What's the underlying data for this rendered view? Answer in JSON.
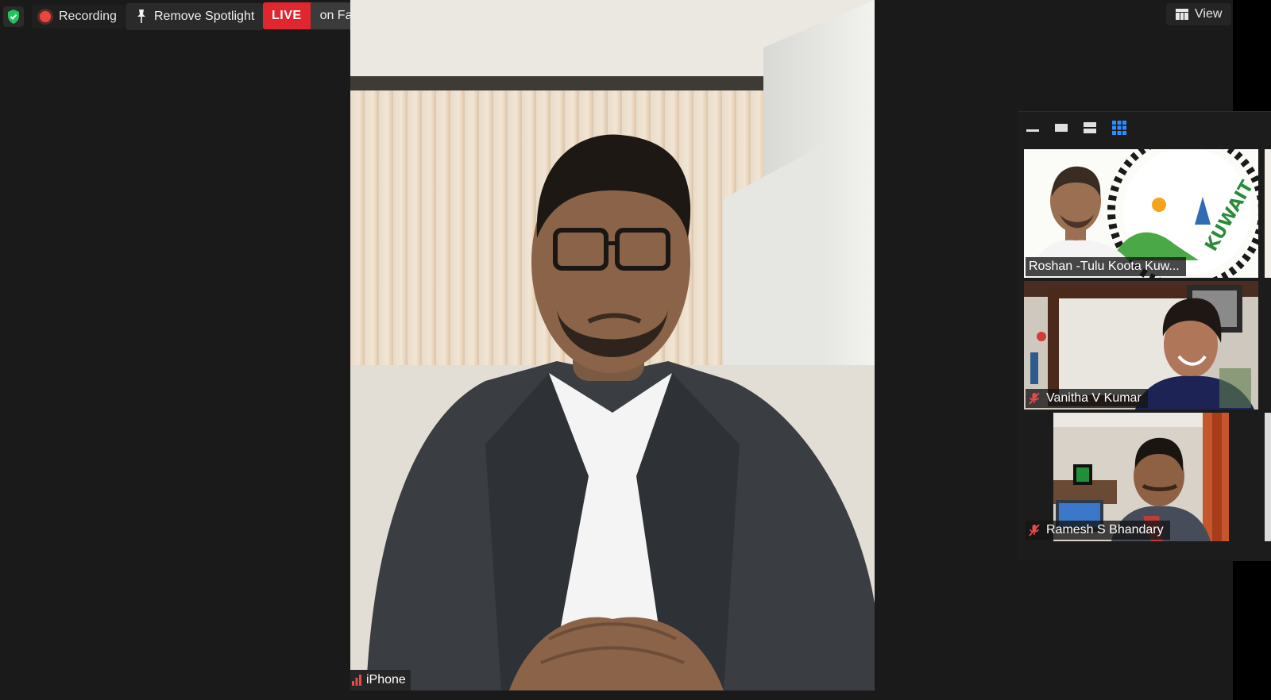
{
  "toolbar": {
    "recording_label": "Recording",
    "spotlight_label": "Remove Spotlight",
    "live_badge": "LIVE",
    "live_destination": "on Facebook",
    "view_label": "View"
  },
  "main_video": {
    "participant_name": "iPhone"
  },
  "gallery": {
    "tiles": [
      {
        "name": "Roshan -Tulu Koota Kuw...",
        "muted": false
      },
      {
        "name": "Vanitha V Kumar",
        "muted": true
      },
      {
        "name": "Ramesh S Bhandary",
        "muted": true
      }
    ],
    "logo_text": "KUWAIT"
  },
  "colors": {
    "live_red": "#e0262f",
    "shield_green": "#23c35b",
    "mute_red": "#e84a4a",
    "active_layout_blue": "#2d8cff"
  },
  "icons": [
    "shield-check-icon",
    "record-icon",
    "pin-icon",
    "dropdown-arrow-icon",
    "grid-view-icon",
    "minimize-icon",
    "thumbnail-icon",
    "strip-view-icon",
    "gallery-grid-icon",
    "signal-bars-icon",
    "mic-muted-icon"
  ]
}
